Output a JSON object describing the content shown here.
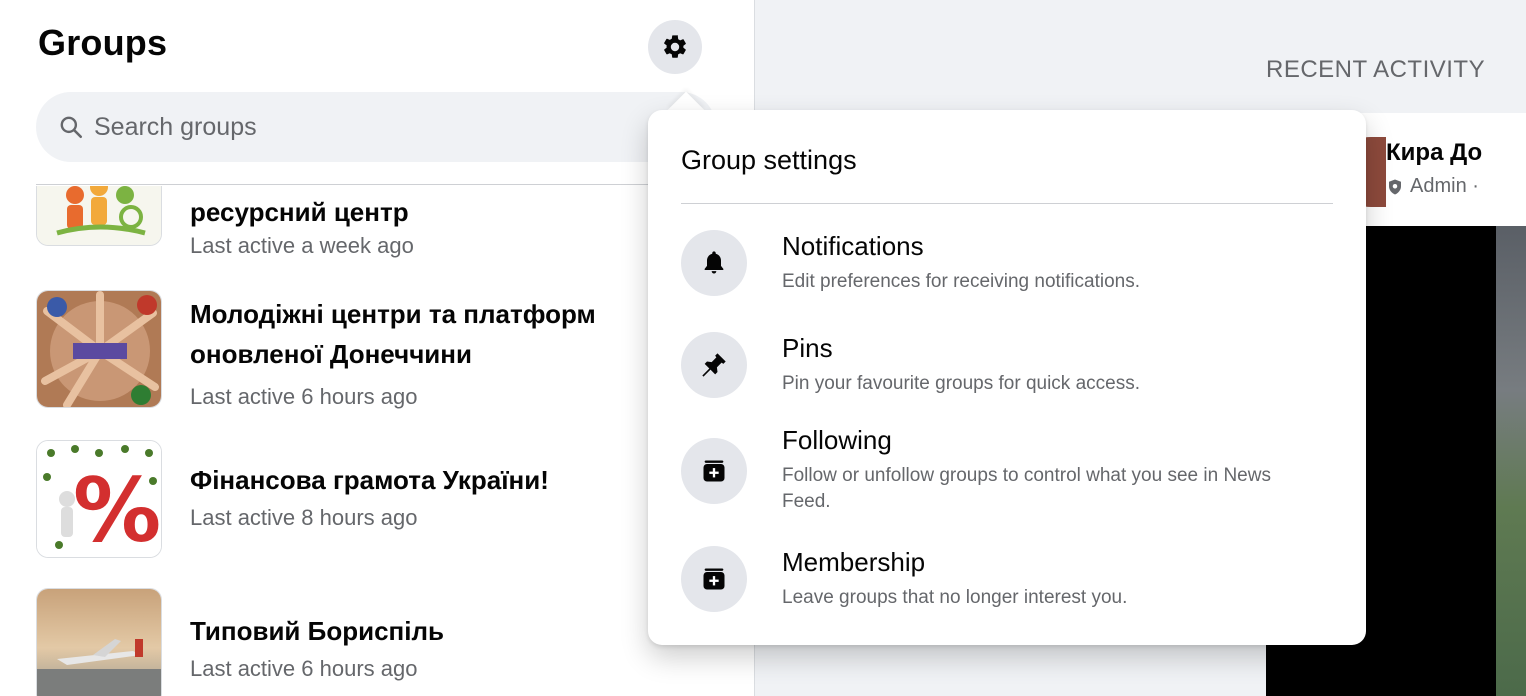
{
  "sidebar": {
    "title": "Groups",
    "search": {
      "placeholder": "Search groups",
      "value": ""
    },
    "groups": [
      {
        "name": "ресурсний центр",
        "meta": "Last active a week ago"
      },
      {
        "name_line1": "Молодіжні центри та платформ",
        "name_line2": "оновленої Донеччини",
        "meta": "Last active 6 hours ago"
      },
      {
        "name": "Фінансова грамота України!",
        "meta": "Last active 8 hours ago"
      },
      {
        "name": "Типовий Бориспіль",
        "meta": "Last active 6 hours ago"
      }
    ]
  },
  "right": {
    "section_title": "RECENT ACTIVITY",
    "post": {
      "author": "Кира До",
      "role": "Admin ·"
    }
  },
  "dropdown": {
    "title": "Group settings",
    "items": [
      {
        "label": "Notifications",
        "desc": "Edit preferences for receiving notifications.",
        "icon": "bell-icon"
      },
      {
        "label": "Pins",
        "desc": "Pin your favourite groups for quick access.",
        "icon": "pin-icon"
      },
      {
        "label": "Following",
        "desc": "Follow or unfollow groups to control what you see in News Feed.",
        "icon": "feed-plus-icon"
      },
      {
        "label": "Membership",
        "desc": "Leave groups that no longer interest you.",
        "icon": "feed-plus-icon"
      }
    ]
  },
  "colors": {
    "text_primary": "#050505",
    "text_secondary": "#65676b",
    "icon_bg": "#e4e6eb",
    "page_bg": "#f0f2f5"
  }
}
